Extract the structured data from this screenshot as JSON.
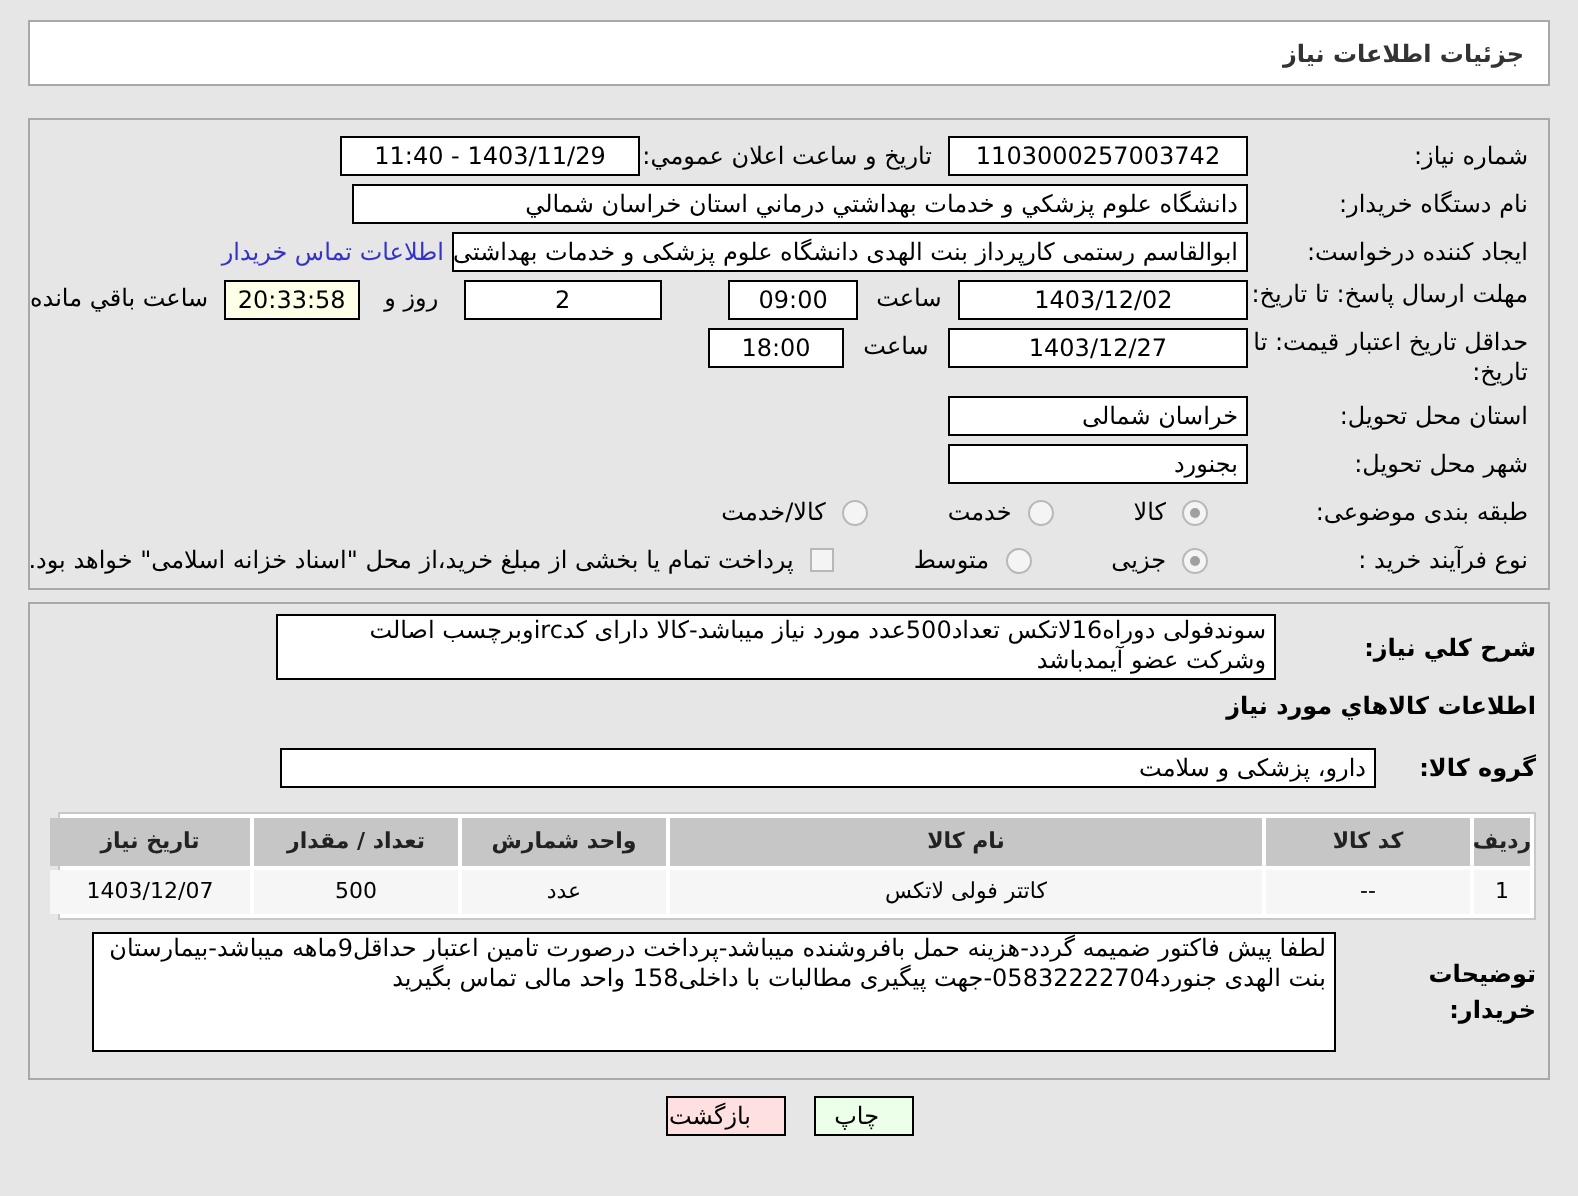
{
  "header": {
    "title": "جزئیات اطلاعات نیاز"
  },
  "need_number": {
    "label": "شماره نیاز:",
    "value": "1103000257003742"
  },
  "announce": {
    "label": "تاريخ و ساعت اعلان عمومي:",
    "value": "1403/11/29 - 11:40"
  },
  "buyer_org": {
    "label": "نام دستگاه خریدار:",
    "value": "دانشگاه علوم پزشكي و خدمات بهداشتي درماني استان خراسان شمالي"
  },
  "requester": {
    "label": "ایجاد کننده درخواست:",
    "value": "ابوالقاسم رستمی کارپرداز بنت الهدی دانشگاه علوم پزشکی و خدمات بهداشتی",
    "link": "اطلاعات تماس خریدار"
  },
  "deadline": {
    "label": "مهلت ارسال پاسخ: تا تاریخ:",
    "date": "1403/12/02",
    "time_label": "ساعت",
    "time": "09:00",
    "days": "2",
    "days_label": "روز و",
    "remaining": "20:33:58",
    "remaining_label": "ساعت باقي مانده"
  },
  "validity": {
    "label": "حداقل تاریخ اعتبار قیمت: تا تاریخ:",
    "date": "1403/12/27",
    "time_label": "ساعت",
    "time": "18:00"
  },
  "province": {
    "label": "استان محل تحویل:",
    "value": "خراسان شمالی"
  },
  "city": {
    "label": "شهر محل تحویل:",
    "value": "بجنورد"
  },
  "category": {
    "label": "طبقه بندی موضوعی:",
    "options": [
      {
        "label": "کالا",
        "selected": true
      },
      {
        "label": "خدمت",
        "selected": false
      },
      {
        "label": "کالا/خدمت",
        "selected": false
      }
    ]
  },
  "purchase_type": {
    "label": "نوع فرآیند خرید :",
    "options": [
      {
        "label": "جزیی",
        "selected": true
      },
      {
        "label": "متوسط",
        "selected": false
      }
    ],
    "payment_check": {
      "label": "پرداخت تمام یا بخشی از مبلغ خرید،از محل \"اسناد خزانه اسلامی\" خواهد بود.",
      "checked": false
    }
  },
  "description": {
    "label": "شرح کلي نياز:",
    "value": "سوندفولی دوراه16لاتکس تعداد500عدد مورد نیاز میباشد-کالا دارای کدircوبرچسب اصالت وشرکت عضو آیمدباشد"
  },
  "goods_title": "اطلاعات كالاهاي مورد نياز",
  "goods_group": {
    "label": "گروه کالا:",
    "value": "دارو، پزشکی و سلامت"
  },
  "table": {
    "columns": [
      "رديف",
      "کد کالا",
      "نام کالا",
      "واحد شمارش",
      "تعداد / مقدار",
      "تاریخ نیاز"
    ],
    "rows": [
      [
        "1",
        "--",
        "کاتتر فولی لاتکس",
        "عدد",
        "500",
        "1403/12/07"
      ]
    ]
  },
  "buyer_notes": {
    "label": "توضیحات خریدار:",
    "value": "لطفا پیش فاکتور ضمیمه گردد-هزینه حمل بافروشنده میباشد-پرداخت درصورت تامین اعتبار حداقل9ماهه میباشد-بیمارستان بنت الهدی جنورد05832222704-جهت پیگیری مطالبات با داخلی158 واحد مالی تماس بگیرید"
  },
  "buttons": [
    {
      "label": "چاپ",
      "kind": "print"
    },
    {
      "label": "بازگشت",
      "kind": "back"
    }
  ]
}
